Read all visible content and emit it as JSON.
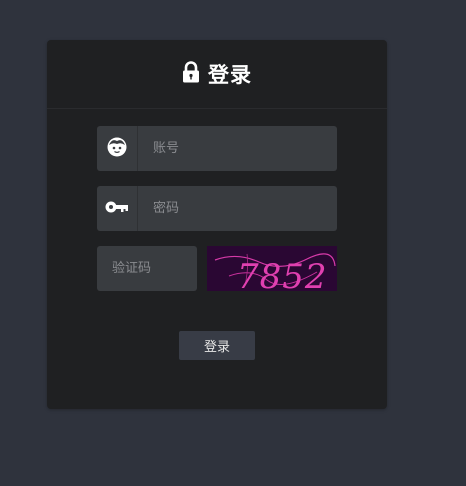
{
  "header": {
    "title": "登录",
    "icon": "lock-icon"
  },
  "form": {
    "username": {
      "icon": "face-icon",
      "placeholder": "账号",
      "value": ""
    },
    "password": {
      "icon": "key-icon",
      "placeholder": "密码",
      "value": ""
    },
    "captcha": {
      "placeholder": "验证码",
      "value": "",
      "image_text": "7852"
    },
    "submit_label": "登录"
  },
  "colors": {
    "page_background": "#2f333d",
    "card_background": "#1f2022",
    "input_background": "#393c40",
    "button_background": "#383c46",
    "captcha_background": "#2a0733",
    "captcha_text": "#e040b0"
  }
}
